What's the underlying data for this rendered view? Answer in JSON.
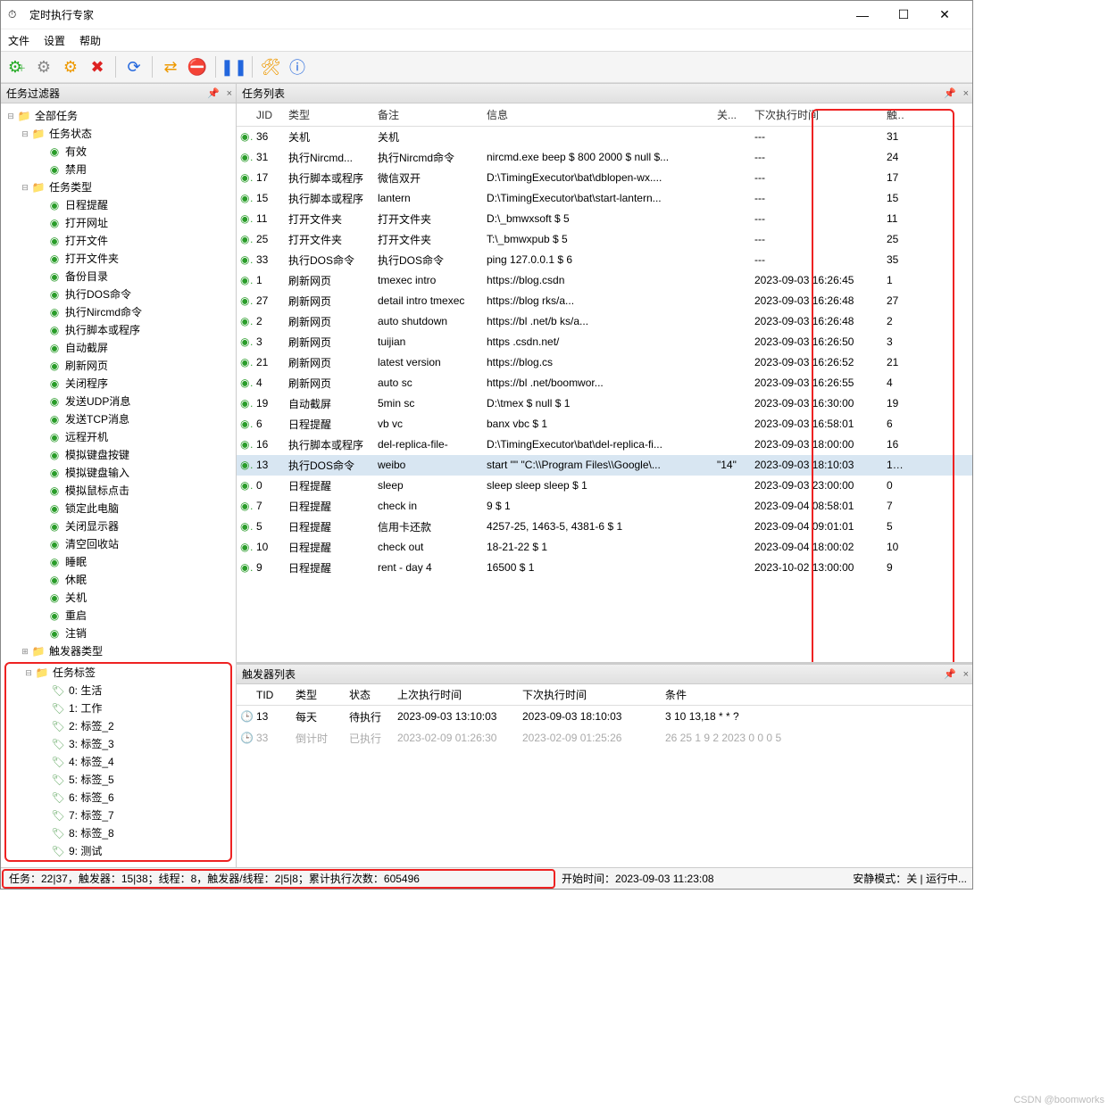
{
  "title": "定时执行专家",
  "menu": {
    "file": "文件",
    "settings": "设置",
    "help": "帮助"
  },
  "panels": {
    "filter": "任务过滤器",
    "tasklist": "任务列表",
    "triggerlist": "触发器列表"
  },
  "task_headers": {
    "jid": "JID",
    "type": "类型",
    "note": "备注",
    "info": "信息",
    "guan": "关...",
    "next": "下次执行时间",
    "chu": "触..."
  },
  "trigger_headers": {
    "tid": "TID",
    "type": "类型",
    "status": "状态",
    "last": "上次执行时间",
    "next": "下次执行时间",
    "cond": "条件"
  },
  "tree": {
    "root": "全部任务",
    "status": {
      "label": "任务状态",
      "children": [
        "有效",
        "禁用"
      ]
    },
    "type": {
      "label": "任务类型",
      "children": [
        "日程提醒",
        "打开网址",
        "打开文件",
        "打开文件夹",
        "备份目录",
        "执行DOS命令",
        "执行Nircmd命令",
        "执行脚本或程序",
        "自动截屏",
        "刷新网页",
        "关闭程序",
        "发送UDP消息",
        "发送TCP消息",
        "远程开机",
        "模拟键盘按键",
        "模拟键盘输入",
        "模拟鼠标点击",
        "锁定此电脑",
        "关闭显示器",
        "清空回收站",
        "睡眠",
        "休眠",
        "关机",
        "重启",
        "注销"
      ]
    },
    "trigger_type": "触发器类型",
    "tags": {
      "label": "任务标签",
      "children": [
        "0: 生活",
        "1: 工作",
        "2: 标签_2",
        "3: 标签_3",
        "4: 标签_4",
        "5: 标签_5",
        "6: 标签_6",
        "7: 标签_7",
        "8: 标签_8",
        "9: 测试"
      ]
    }
  },
  "tasks": [
    {
      "jid": "36",
      "type": "关机",
      "note": "关机",
      "info": "",
      "guan": "",
      "next": "---",
      "chu": "31"
    },
    {
      "jid": "31",
      "type": "执行Nircmd...",
      "note": "执行Nircmd命令",
      "info": "nircmd.exe beep $ 800 2000 $ null $...",
      "guan": "",
      "next": "---",
      "chu": "24"
    },
    {
      "jid": "17",
      "type": "执行脚本或程序",
      "note": "微信双开",
      "info": "D:\\TimingExecutor\\bat\\dblopen-wx....",
      "guan": "",
      "next": "---",
      "chu": "17"
    },
    {
      "jid": "15",
      "type": "执行脚本或程序",
      "note": "lantern",
      "info": "D:\\TimingExecutor\\bat\\start-lantern...",
      "guan": "",
      "next": "---",
      "chu": "15"
    },
    {
      "jid": "11",
      "type": "打开文件夹",
      "note": "打开文件夹",
      "info": "D:\\_bmwxsoft $ 5",
      "guan": "",
      "next": "---",
      "chu": "11"
    },
    {
      "jid": "25",
      "type": "打开文件夹",
      "note": "打开文件夹",
      "info": "T:\\_bmwxpub $ 5",
      "guan": "",
      "next": "---",
      "chu": "25"
    },
    {
      "jid": "33",
      "type": "执行DOS命令",
      "note": "执行DOS命令",
      "info": "ping 127.0.0.1 $ 6",
      "guan": "",
      "next": "---",
      "chu": "35"
    },
    {
      "jid": "1",
      "type": "刷新网页",
      "note": "tmexec intro",
      "info": "https://blog.csdn",
      "guan": "",
      "next": "2023-09-03 16:26:45",
      "chu": "1"
    },
    {
      "jid": "27",
      "type": "刷新网页",
      "note": "detail intro tmexec",
      "info": "https://blog                           rks/a...",
      "guan": "",
      "next": "2023-09-03 16:26:48",
      "chu": "27"
    },
    {
      "jid": "2",
      "type": "刷新网页",
      "note": "auto shutdown",
      "info": "https://bl                  .net/b              ks/a...",
      "guan": "",
      "next": "2023-09-03 16:26:48",
      "chu": "2"
    },
    {
      "jid": "3",
      "type": "刷新网页",
      "note": "tuijian",
      "info": "https              .csdn.net/",
      "guan": "",
      "next": "2023-09-03 16:26:50",
      "chu": "3"
    },
    {
      "jid": "21",
      "type": "刷新网页",
      "note": "latest version",
      "info": "https://blog.cs",
      "guan": "",
      "next": "2023-09-03 16:26:52",
      "chu": "21"
    },
    {
      "jid": "4",
      "type": "刷新网页",
      "note": "auto sc",
      "info": "https://bl              .net/boomwor...",
      "guan": "",
      "next": "2023-09-03 16:26:55",
      "chu": "4"
    },
    {
      "jid": "19",
      "type": "自动截屏",
      "note": "5min sc",
      "info": "D:\\tmex        $ null $ 1",
      "guan": "",
      "next": "2023-09-03 16:30:00",
      "chu": "19"
    },
    {
      "jid": "6",
      "type": "日程提醒",
      "note": "vb vc",
      "info": "banx vbc $ 1",
      "guan": "",
      "next": "2023-09-03 16:58:01",
      "chu": "6"
    },
    {
      "jid": "16",
      "type": "执行脚本或程序",
      "note": "del-replica-file-",
      "info": "D:\\TimingExecutor\\bat\\del-replica-fi...",
      "guan": "",
      "next": "2023-09-03 18:00:00",
      "chu": "16"
    },
    {
      "jid": "13",
      "type": "执行DOS命令",
      "note": "weibo",
      "info": "start \"\" \"C:\\\\Program Files\\\\Google\\...",
      "guan": "\"14\"",
      "next": "2023-09-03 18:10:03",
      "chu": "1...",
      "selected": true
    },
    {
      "jid": "0",
      "type": "日程提醒",
      "note": "sleep",
      "info": "sleep sleep sleep $ 1",
      "guan": "",
      "next": "2023-09-03 23:00:00",
      "chu": "0"
    },
    {
      "jid": "7",
      "type": "日程提醒",
      "note": "check in",
      "info": "9 $ 1",
      "guan": "",
      "next": "2023-09-04 08:58:01",
      "chu": "7"
    },
    {
      "jid": "5",
      "type": "日程提醒",
      "note": "信用卡还款",
      "info": "4257-25, 1463-5, 4381-6 $ 1",
      "guan": "",
      "next": "2023-09-04 09:01:01",
      "chu": "5"
    },
    {
      "jid": "10",
      "type": "日程提醒",
      "note": "check out",
      "info": "18-21-22 $ 1",
      "guan": "",
      "next": "2023-09-04 18:00:02",
      "chu": "10"
    },
    {
      "jid": "9",
      "type": "日程提醒",
      "note": "rent - day 4",
      "info": "16500 $ 1",
      "guan": "",
      "next": "2023-10-02 13:00:00",
      "chu": "9"
    }
  ],
  "triggers": [
    {
      "tid": "13",
      "type": "每天",
      "status": "待执行",
      "last": "2023-09-03 13:10:03",
      "next": "2023-09-03 18:10:03",
      "cond": "3 10 13,18 * * ?",
      "disabled": false
    },
    {
      "tid": "33",
      "type": "倒计时",
      "status": "已执行",
      "last": "2023-02-09 01:26:30",
      "next": "2023-02-09 01:25:26",
      "cond": "26 25 1 9 2 2023 0 0 0 5",
      "disabled": true
    }
  ],
  "status": {
    "left": "任务：22|37，触发器：15|38；线程：8，触发器/线程：2|5|8；累计执行次数：605496",
    "start_label": "开始时间：",
    "start_time": "2023-09-03 11:23:08",
    "quiet": "安静模式：关 | 运行中..."
  },
  "watermark": "CSDN @boomworks"
}
